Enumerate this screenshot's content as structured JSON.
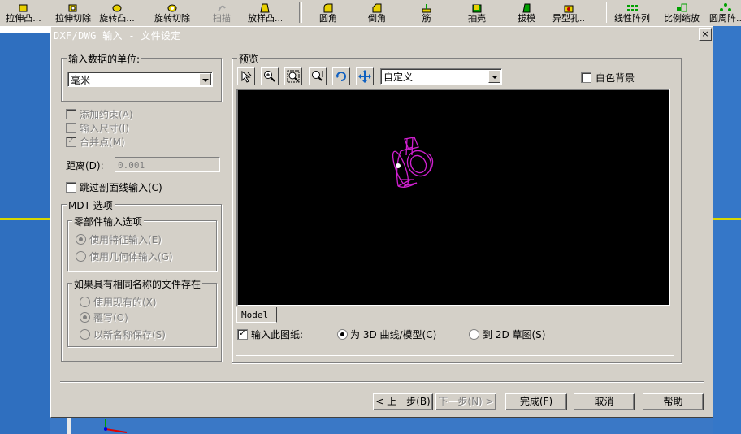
{
  "toolbar": {
    "buttons": [
      {
        "label": "拉伸凸...",
        "icon": "extrude-boss-icon"
      },
      {
        "label": "拉伸切除",
        "icon": "extrude-cut-icon"
      },
      {
        "label": "旋转凸...",
        "icon": "revolve-boss-icon"
      },
      {
        "label": "旋转切除",
        "icon": "revolve-cut-icon"
      },
      {
        "label": "扫描",
        "icon": "sweep-icon"
      },
      {
        "label": "放样凸...",
        "icon": "loft-icon"
      },
      {
        "label": "圆角",
        "icon": "fillet-icon"
      },
      {
        "label": "倒角",
        "icon": "chamfer-icon"
      },
      {
        "label": "筋",
        "icon": "rib-icon"
      },
      {
        "label": "抽壳",
        "icon": "shell-icon"
      },
      {
        "label": "拔模",
        "icon": "draft-icon"
      },
      {
        "label": "异型孔...",
        "icon": "hole-wizard-icon"
      },
      {
        "label": "线性阵列",
        "icon": "linear-pattern-icon"
      },
      {
        "label": "比例缩放",
        "icon": "scale-icon"
      },
      {
        "label": "圆周阵...",
        "icon": "circular-pattern-icon"
      }
    ]
  },
  "dialog": {
    "title": "DXF/DWG 输入 - 文件设定",
    "close": "×",
    "units": {
      "legend": "输入数据的单位:",
      "value": "毫米"
    },
    "add_constraints": {
      "label": "添加约束(A)",
      "checked": false
    },
    "import_dims": {
      "label": "输入尺寸(I)",
      "checked": false
    },
    "merge_points": {
      "label": "合并点(M)",
      "checked": true,
      "mark": "✓"
    },
    "distance": {
      "label": "距离(D):",
      "value": "0.001"
    },
    "skip_hatch": {
      "label": "跳过剖面线输入(C)",
      "checked": false
    },
    "mdt": {
      "legend": "MDT 选项",
      "part_import": {
        "legend": "零部件输入选项",
        "options": [
          "使用特征输入(E)",
          "使用几何体输入(G)"
        ],
        "selected": 0
      },
      "same_name": {
        "legend": "如果具有相同名称的文件存在",
        "options": [
          "使用现有的(X)",
          "覆写(O)",
          "以新名称保存(S)"
        ],
        "selected": 1
      }
    },
    "preview": {
      "legend": "预览",
      "view_value": "自定义",
      "white_bg": {
        "label": "白色背景",
        "checked": false
      },
      "tool_icons": [
        "select-icon",
        "zoom-in-icon",
        "zoom-window-icon",
        "zoom-fit-icon",
        "rotate-icon",
        "pan-icon"
      ],
      "model_color": "#d020d0",
      "tab": "Model",
      "import_sheet": {
        "label": "输入此图纸:",
        "checked": true,
        "mark": "✓"
      },
      "as_3d": "为 3D 曲线/模型(C)",
      "as_2d": "到 2D 草图(S)",
      "mode_selected": "3d"
    },
    "buttons": {
      "back": "< 上一步(B)",
      "next": "下一步(N) >",
      "finish": "完成(F)",
      "cancel": "取消",
      "help": "帮助"
    }
  }
}
